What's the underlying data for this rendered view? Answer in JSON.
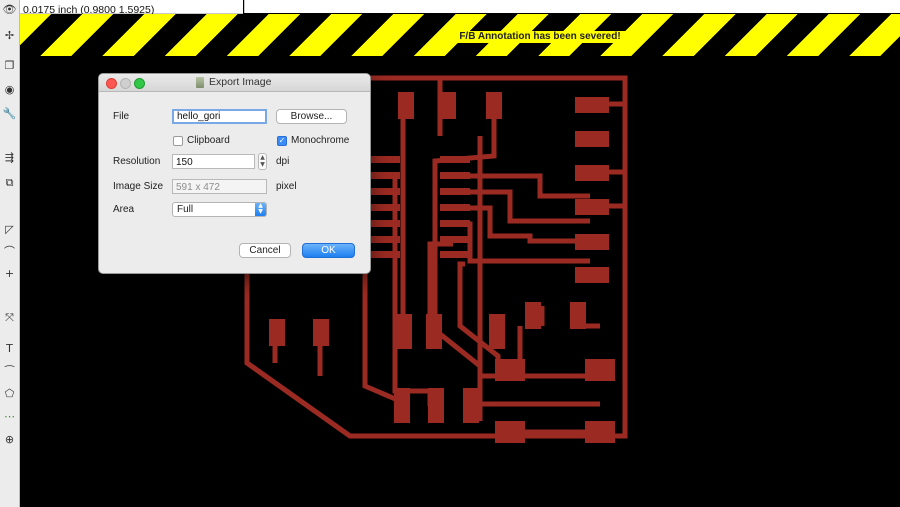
{
  "app": {
    "coordinates_readout": "0.0175 inch (0.9800 1.5925)",
    "warning_banner": "F/B Annotation has been severed!"
  },
  "toolbar": {
    "tools": [
      {
        "icon": "eye-icon",
        "glyph": "👁"
      },
      {
        "icon": "move-icon",
        "glyph": "✢"
      },
      {
        "icon": "copy-icon",
        "glyph": "❐"
      },
      {
        "icon": "circle-icon",
        "glyph": "◉"
      },
      {
        "icon": "wrench-icon",
        "glyph": "🔧"
      },
      {
        "icon": "split-icon",
        "glyph": "⇶"
      },
      {
        "icon": "group-icon",
        "glyph": "⧉"
      },
      {
        "icon": "miter-icon",
        "glyph": "◸"
      },
      {
        "icon": "arc-icon",
        "glyph": "⌒"
      },
      {
        "icon": "add-icon",
        "glyph": "+"
      },
      {
        "icon": "route-icon",
        "glyph": "⤧"
      },
      {
        "icon": "text-icon",
        "glyph": "T"
      },
      {
        "icon": "curve-icon",
        "glyph": "⁀"
      },
      {
        "icon": "polygon-icon",
        "glyph": "⬠"
      },
      {
        "icon": "wire-icon",
        "glyph": "⋯"
      },
      {
        "icon": "via-icon",
        "glyph": "⊕"
      }
    ]
  },
  "dialog": {
    "title": "Export Image",
    "file_label": "File",
    "file_value": "hello_gori",
    "browse_label": "Browse...",
    "clipboard_label": "Clipboard",
    "clipboard_checked": false,
    "monochrome_label": "Monochrome",
    "monochrome_checked": true,
    "resolution_label": "Resolution",
    "resolution_value": "150",
    "resolution_unit": "dpi",
    "image_size_label": "Image Size",
    "image_size_value": "591 x 472",
    "image_size_unit": "pixel",
    "area_label": "Area",
    "area_value": "Full",
    "cancel_label": "Cancel",
    "ok_label": "OK"
  },
  "colors": {
    "trace": "#9b2a22",
    "hazard_yellow": "#ffff00",
    "background": "#000000",
    "accent_blue": "#1e7ff1"
  }
}
